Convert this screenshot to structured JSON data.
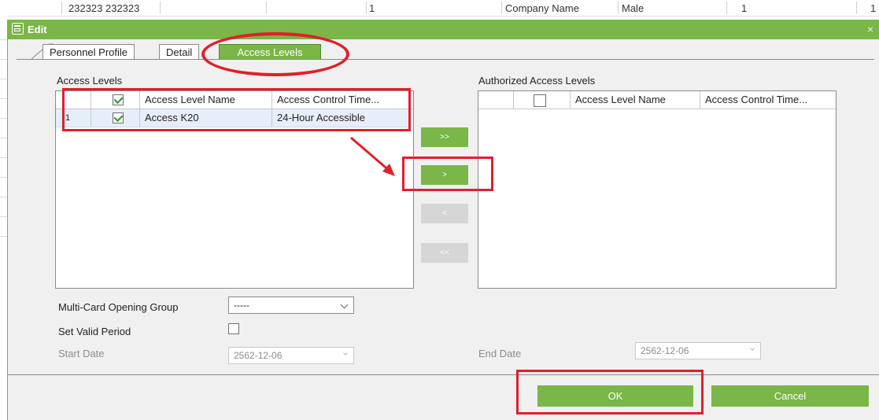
{
  "background_row": {
    "cells": [
      "232323 232323",
      "1",
      "Company Name",
      "Male",
      "1",
      "1"
    ]
  },
  "dialog": {
    "title": "Edit",
    "close_glyph": "×"
  },
  "tabs": [
    {
      "label": "Personnel Profile",
      "active": false
    },
    {
      "label": "Detail",
      "active": false
    },
    {
      "label": "Access Levels",
      "active": true
    }
  ],
  "access_levels": {
    "label": "Access Levels",
    "columns": [
      "",
      "",
      "Access Level Name",
      "Access Control Time..."
    ],
    "header_checked": true,
    "rows": [
      {
        "index": "1",
        "checked": true,
        "name": "Access K20",
        "time": "24-Hour Accessible"
      }
    ]
  },
  "authorized_levels": {
    "label": "Authorized Access Levels",
    "columns": [
      "",
      "",
      "Access Level Name",
      "Access Control Time..."
    ],
    "header_checked": false,
    "rows": []
  },
  "transfer_buttons": [
    {
      "label": ">>",
      "enabled": true
    },
    {
      "label": ">",
      "enabled": true
    },
    {
      "label": "<",
      "enabled": false
    },
    {
      "label": "<<",
      "enabled": false
    }
  ],
  "form": {
    "multi_card_label": "Multi-Card Opening Group",
    "multi_card_value": "-----",
    "valid_period_label": "Set Valid Period",
    "valid_period_checked": false,
    "start_date_label": "Start Date",
    "start_date_value": "2562-12-06",
    "end_date_label": "End Date",
    "end_date_value": "2562-12-06"
  },
  "footer": {
    "ok_label": "OK",
    "cancel_label": "Cancel"
  },
  "colors": {
    "accent": "#7ab648",
    "highlight": "#e0202a",
    "row_selected": "#e6eef9"
  },
  "icons": [
    "edit-icon",
    "close-icon",
    "checkbox-icon",
    "chevron-down-icon",
    "arrow-icon"
  ]
}
